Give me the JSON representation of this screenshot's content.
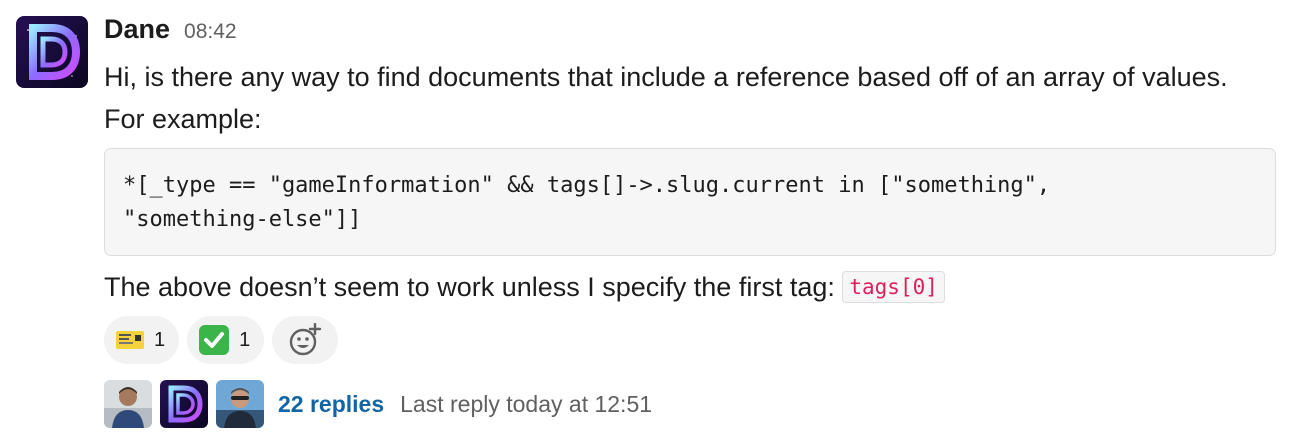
{
  "message": {
    "author": "Dane",
    "time": "08:42",
    "text": "Hi, is there any way to find documents that include a reference based off of an array of values. For example:",
    "code": "*[_type == \"gameInformation\" && tags[]->.slug.current in [\"something\",\n\"something-else\"]]",
    "follow_text": "The above doesn’t seem to work unless I specify the first tag: ",
    "inline_code": "tags[0]"
  },
  "reactions": [
    {
      "icon": "concert-ticket-icon",
      "count": "1"
    },
    {
      "icon": "white-check-mark-icon",
      "count": "1"
    }
  ],
  "add_reaction_icon": "add-emoji-icon",
  "thread": {
    "replies_label": "22 replies",
    "last_reply": "Last reply today at 12:51"
  },
  "colors": {
    "link": "#1264a3",
    "inline_code": "#e01e5a",
    "check_green": "#3bb44a"
  }
}
